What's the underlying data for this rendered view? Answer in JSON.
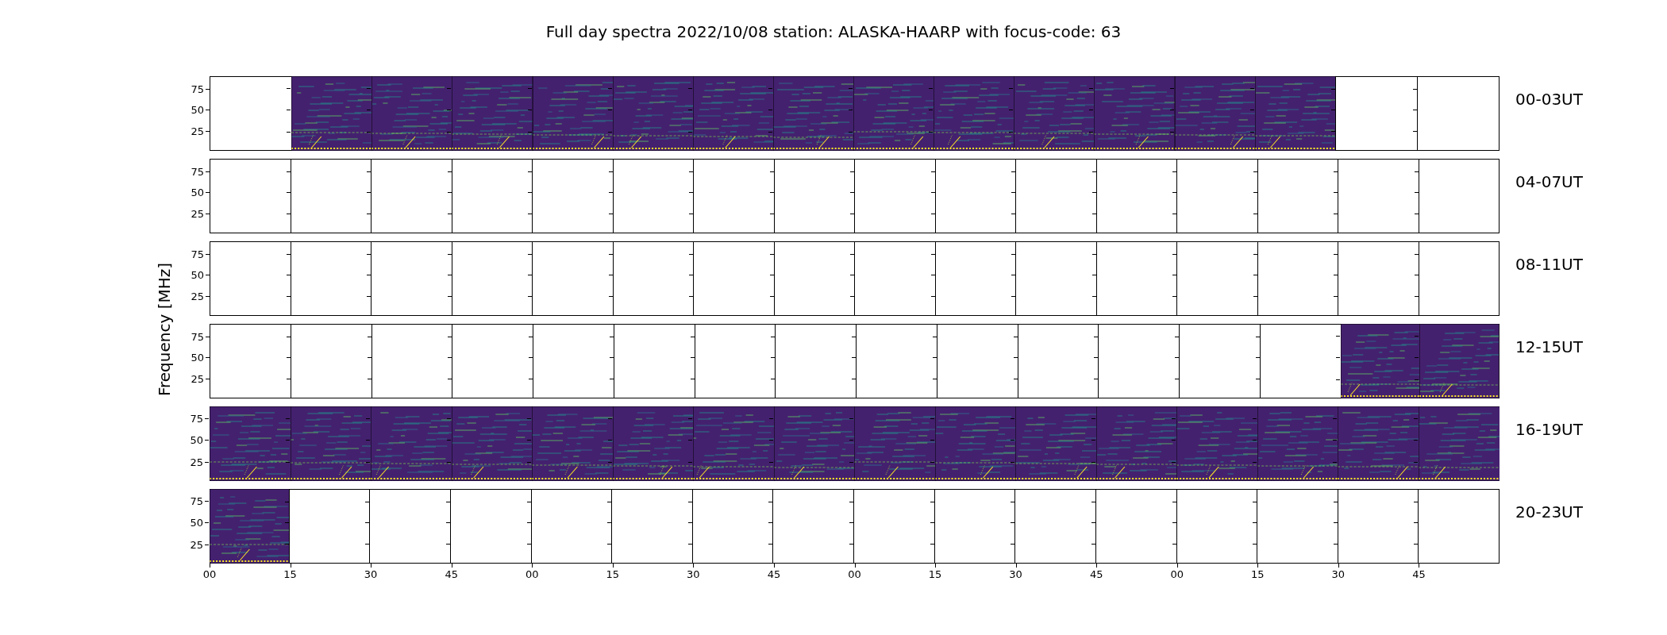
{
  "title": "Full day spectra 2022/10/08 station: ALASKA-HAARP with focus-code: 63",
  "ylabel": "Frequency [MHz]",
  "x_tick_labels": [
    "00",
    "15",
    "30",
    "45",
    "00",
    "15",
    "30",
    "45",
    "00",
    "15",
    "30",
    "45",
    "00",
    "15",
    "30",
    "45"
  ],
  "rows": [
    {
      "label": "00-03UT",
      "y_tick_labels": [
        "75",
        "50",
        "25"
      ],
      "cells": [
        {
          "filled": false
        },
        {
          "filled": true
        },
        {
          "filled": true
        },
        {
          "filled": true
        },
        {
          "filled": true
        },
        {
          "filled": true
        },
        {
          "filled": true
        },
        {
          "filled": true
        },
        {
          "filled": true
        },
        {
          "filled": true
        },
        {
          "filled": true
        },
        {
          "filled": true
        },
        {
          "filled": true
        },
        {
          "filled": true
        },
        {
          "filled": false
        },
        {
          "filled": false
        }
      ]
    },
    {
      "label": "04-07UT",
      "y_tick_labels": [
        "75",
        "50",
        "25"
      ],
      "cells": [
        {
          "filled": false
        },
        {
          "filled": false
        },
        {
          "filled": false
        },
        {
          "filled": false
        },
        {
          "filled": false
        },
        {
          "filled": false
        },
        {
          "filled": false
        },
        {
          "filled": false
        },
        {
          "filled": false
        },
        {
          "filled": false
        },
        {
          "filled": false
        },
        {
          "filled": false
        },
        {
          "filled": false
        },
        {
          "filled": false
        },
        {
          "filled": false
        },
        {
          "filled": false
        }
      ]
    },
    {
      "label": "08-11UT",
      "y_tick_labels": [
        "75",
        "50",
        "25"
      ],
      "cells": [
        {
          "filled": false
        },
        {
          "filled": false
        },
        {
          "filled": false
        },
        {
          "filled": false
        },
        {
          "filled": false
        },
        {
          "filled": false
        },
        {
          "filled": false
        },
        {
          "filled": false
        },
        {
          "filled": false
        },
        {
          "filled": false
        },
        {
          "filled": false
        },
        {
          "filled": false
        },
        {
          "filled": false
        },
        {
          "filled": false
        },
        {
          "filled": false
        },
        {
          "filled": false
        }
      ]
    },
    {
      "label": "12-15UT",
      "y_tick_labels": [
        "75",
        "50",
        "25"
      ],
      "cells": [
        {
          "filled": false
        },
        {
          "filled": false
        },
        {
          "filled": false
        },
        {
          "filled": false
        },
        {
          "filled": false
        },
        {
          "filled": false
        },
        {
          "filled": false
        },
        {
          "filled": false
        },
        {
          "filled": false
        },
        {
          "filled": false
        },
        {
          "filled": false
        },
        {
          "filled": false
        },
        {
          "filled": false
        },
        {
          "filled": false
        },
        {
          "filled": true
        },
        {
          "filled": true
        }
      ]
    },
    {
      "label": "16-19UT",
      "y_tick_labels": [
        "75",
        "50",
        "25"
      ],
      "cells": [
        {
          "filled": true
        },
        {
          "filled": true
        },
        {
          "filled": true
        },
        {
          "filled": true
        },
        {
          "filled": true
        },
        {
          "filled": true
        },
        {
          "filled": true
        },
        {
          "filled": true
        },
        {
          "filled": true
        },
        {
          "filled": true
        },
        {
          "filled": true
        },
        {
          "filled": true
        },
        {
          "filled": true
        },
        {
          "filled": true
        },
        {
          "filled": true
        },
        {
          "filled": true
        }
      ]
    },
    {
      "label": "20-23UT",
      "y_tick_labels": [
        "75",
        "50",
        "25"
      ],
      "cells": [
        {
          "filled": true
        },
        {
          "filled": false
        },
        {
          "filled": false
        },
        {
          "filled": false
        },
        {
          "filled": false
        },
        {
          "filled": false
        },
        {
          "filled": false
        },
        {
          "filled": false
        },
        {
          "filled": false
        },
        {
          "filled": false
        },
        {
          "filled": false
        },
        {
          "filled": false
        },
        {
          "filled": false
        },
        {
          "filled": false
        },
        {
          "filled": false
        },
        {
          "filled": false
        }
      ]
    }
  ]
}
